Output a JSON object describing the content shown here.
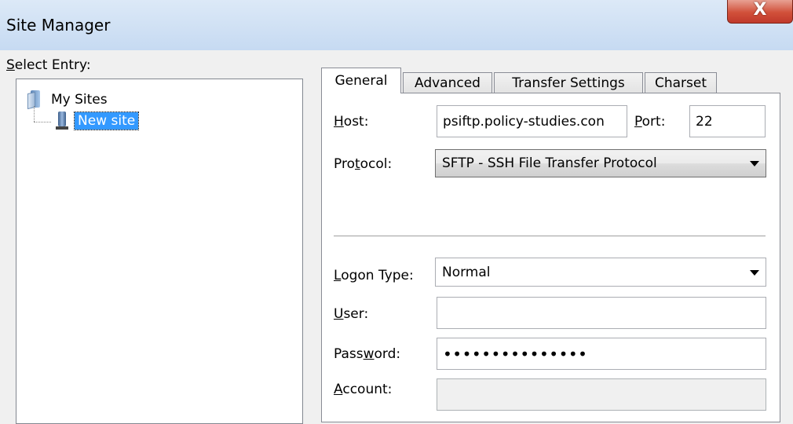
{
  "window": {
    "title": "Site Manager",
    "close_glyph": "X"
  },
  "tree": {
    "label_prefix": "",
    "label_mnemonic": "S",
    "label_rest": "elect Entry:",
    "root": {
      "label": "My Sites",
      "icon": "folder-icon"
    },
    "child": {
      "label": "New site",
      "icon": "server-icon",
      "selected": true
    }
  },
  "tabs": [
    {
      "label": "General",
      "active": true
    },
    {
      "label": "Advanced",
      "active": false
    },
    {
      "label": "Transfer Settings",
      "active": false
    },
    {
      "label": "Charset",
      "active": false
    }
  ],
  "general": {
    "host": {
      "label_mnemonic": "H",
      "label_rest": "ost:",
      "value": "psiftp.policy-studies.con"
    },
    "port": {
      "label_mnemonic": "P",
      "label_rest": "ort:",
      "value": "22"
    },
    "protocol": {
      "label_prefix": "Pro",
      "label_mnemonic": "t",
      "label_rest": "ocol:",
      "value": "SFTP - SSH File Transfer Protocol"
    },
    "logon_type": {
      "label_mnemonic": "L",
      "label_rest": "ogon Type:",
      "value": "Normal"
    },
    "user": {
      "label_mnemonic": "U",
      "label_rest": "ser:",
      "value": ""
    },
    "password": {
      "label_prefix": "Pass",
      "label_mnemonic": "w",
      "label_rest": "ord:",
      "value": "•••••••••••••••"
    },
    "account": {
      "label_mnemonic": "A",
      "label_rest": "ccount:",
      "value": ""
    }
  }
}
